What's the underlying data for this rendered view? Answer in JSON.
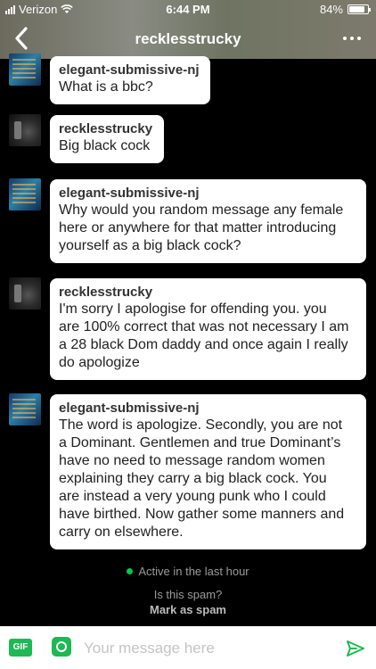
{
  "status": {
    "carrier": "Verizon",
    "time": "6:44 PM",
    "battery": "84%",
    "battery_level": 0.84
  },
  "header": {
    "title": "recklesstrucky"
  },
  "messages": [
    {
      "sender": "elegant-submissive-nj",
      "text": "What is a bbc?"
    },
    {
      "sender": "recklesstrucky",
      "text": "Big black cock"
    },
    {
      "sender": "elegant-submissive-nj",
      "text": "Why would you random message any female\nhere or anywhere for that matter introducing\nyourself as a big black cock?"
    },
    {
      "sender": "recklesstrucky",
      "text": "I'm sorry I apologise for offending you. you\nare 100% correct that was not necessary I am\na 28 black Dom daddy and once again I really\ndo apologize"
    },
    {
      "sender": "elegant-submissive-nj",
      "text": "The word is apologize. Secondly, you are not\na Dominant. Gentlemen and true Dominant’s\nhave no need to message random women\nexplaining they carry a big black cock. You\nare instead a very young punk who I could\nhave birthed. Now gather some manners and\ncarry on elsewhere."
    }
  ],
  "presence": {
    "text": "Active in the last hour"
  },
  "spam": {
    "question": "Is this spam?",
    "link": "Mark as spam"
  },
  "composer": {
    "gif_label": "GIF",
    "placeholder": "Your message here"
  },
  "colors": {
    "accent": "#1db954",
    "bubble": "#ffffff",
    "background": "#000000"
  }
}
